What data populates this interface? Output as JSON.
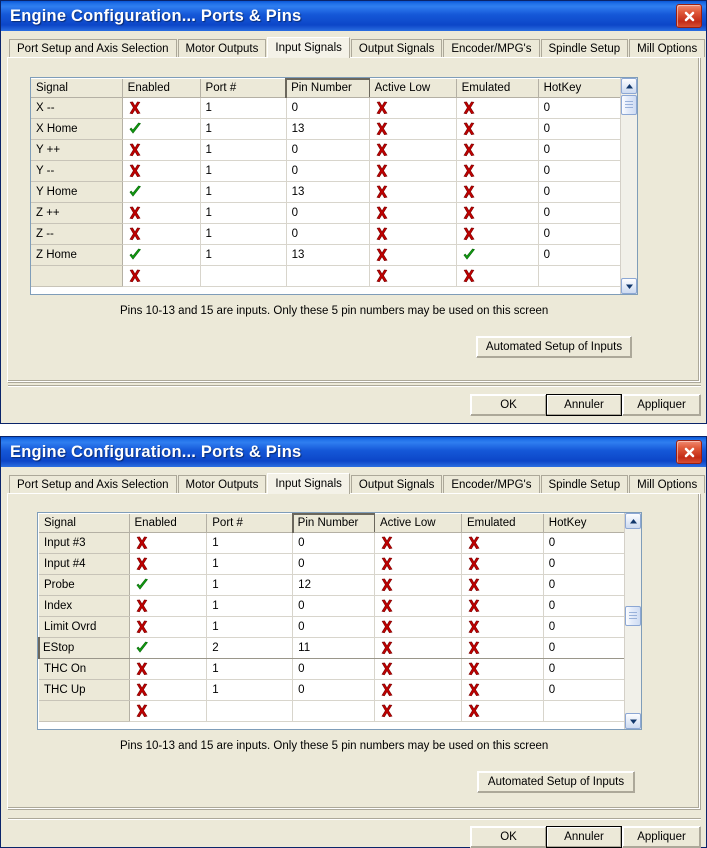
{
  "meta": {
    "accent_title_blue": "#1558d8",
    "dialog_face": "#ece9d8",
    "grid_border": "#7f9db9",
    "check_green": "#19a019",
    "cross_red": "#c00000"
  },
  "icons": {
    "close": "close-icon",
    "check": "green-check-icon",
    "cross": "red-cross-icon",
    "scroll_up": "chevron-up-icon",
    "scroll_down": "chevron-down-icon"
  },
  "dialogs": [
    {
      "title": "Engine Configuration... Ports & Pins",
      "close_label": "✕",
      "tabs": [
        {
          "label": "Port Setup and Axis Selection",
          "active": false
        },
        {
          "label": "Motor Outputs",
          "active": false
        },
        {
          "label": "Input Signals",
          "active": true
        },
        {
          "label": "Output Signals",
          "active": false
        },
        {
          "label": "Encoder/MPG's",
          "active": false
        },
        {
          "label": "Spindle Setup",
          "active": false
        },
        {
          "label": "Mill Options",
          "active": false
        }
      ],
      "grid": {
        "columns": [
          "Signal",
          "Enabled",
          "Port #",
          "Pin Number",
          "Active Low",
          "Emulated",
          "HotKey"
        ],
        "selected_column": "Pin Number",
        "selected_row": null,
        "rows": [
          {
            "signal": "X --",
            "enabled": "cross",
            "port": "1",
            "pin": "0",
            "active_low": "cross",
            "emulated": "cross",
            "hotkey": "0"
          },
          {
            "signal": "X Home",
            "enabled": "check",
            "port": "1",
            "pin": "13",
            "active_low": "cross",
            "emulated": "cross",
            "hotkey": "0"
          },
          {
            "signal": "Y ++",
            "enabled": "cross",
            "port": "1",
            "pin": "0",
            "active_low": "cross",
            "emulated": "cross",
            "hotkey": "0"
          },
          {
            "signal": "Y --",
            "enabled": "cross",
            "port": "1",
            "pin": "0",
            "active_low": "cross",
            "emulated": "cross",
            "hotkey": "0"
          },
          {
            "signal": "Y Home",
            "enabled": "check",
            "port": "1",
            "pin": "13",
            "active_low": "cross",
            "emulated": "cross",
            "hotkey": "0"
          },
          {
            "signal": "Z ++",
            "enabled": "cross",
            "port": "1",
            "pin": "0",
            "active_low": "cross",
            "emulated": "cross",
            "hotkey": "0"
          },
          {
            "signal": "Z --",
            "enabled": "cross",
            "port": "1",
            "pin": "0",
            "active_low": "cross",
            "emulated": "cross",
            "hotkey": "0"
          },
          {
            "signal": "Z Home",
            "enabled": "check",
            "port": "1",
            "pin": "13",
            "active_low": "cross",
            "emulated": "check",
            "hotkey": "0"
          }
        ],
        "scroll_position": "top"
      },
      "hint": "Pins 10-13 and 15 are inputs. Only these 5 pin numbers may be used on this screen",
      "auto_button": "Automated Setup of Inputs",
      "footer_buttons": [
        {
          "label": "OK",
          "default": false
        },
        {
          "label": "Annuler",
          "default": true
        },
        {
          "label": "Appliquer",
          "default": false
        }
      ]
    },
    {
      "title": "Engine Configuration... Ports & Pins",
      "close_label": "✕",
      "tabs": [
        {
          "label": "Port Setup and Axis Selection",
          "active": false
        },
        {
          "label": "Motor Outputs",
          "active": false
        },
        {
          "label": "Input Signals",
          "active": true
        },
        {
          "label": "Output Signals",
          "active": false
        },
        {
          "label": "Encoder/MPG's",
          "active": false
        },
        {
          "label": "Spindle Setup",
          "active": false
        },
        {
          "label": "Mill Options",
          "active": false
        }
      ],
      "grid": {
        "columns": [
          "Signal",
          "Enabled",
          "Port #",
          "Pin Number",
          "Active Low",
          "Emulated",
          "HotKey"
        ],
        "selected_column": "Pin Number",
        "selected_row": "EStop",
        "rows": [
          {
            "signal": "Input #3",
            "enabled": "cross",
            "port": "1",
            "pin": "0",
            "active_low": "cross",
            "emulated": "cross",
            "hotkey": "0"
          },
          {
            "signal": "Input #4",
            "enabled": "cross",
            "port": "1",
            "pin": "0",
            "active_low": "cross",
            "emulated": "cross",
            "hotkey": "0"
          },
          {
            "signal": "Probe",
            "enabled": "check",
            "port": "1",
            "pin": "12",
            "active_low": "cross",
            "emulated": "cross",
            "hotkey": "0"
          },
          {
            "signal": "Index",
            "enabled": "cross",
            "port": "1",
            "pin": "0",
            "active_low": "cross",
            "emulated": "cross",
            "hotkey": "0"
          },
          {
            "signal": "Limit Ovrd",
            "enabled": "cross",
            "port": "1",
            "pin": "0",
            "active_low": "cross",
            "emulated": "cross",
            "hotkey": "0"
          },
          {
            "signal": "EStop",
            "enabled": "check",
            "port": "2",
            "pin": "11",
            "active_low": "cross",
            "emulated": "cross",
            "hotkey": "0"
          },
          {
            "signal": "THC On",
            "enabled": "cross",
            "port": "1",
            "pin": "0",
            "active_low": "cross",
            "emulated": "cross",
            "hotkey": "0"
          },
          {
            "signal": "THC Up",
            "enabled": "cross",
            "port": "1",
            "pin": "0",
            "active_low": "cross",
            "emulated": "cross",
            "hotkey": "0"
          }
        ],
        "scroll_position": "middle"
      },
      "hint": "Pins 10-13 and 15 are inputs. Only these 5 pin numbers may be used on this screen",
      "auto_button": "Automated Setup of Inputs",
      "footer_buttons": [
        {
          "label": "OK",
          "default": false
        },
        {
          "label": "Annuler",
          "default": true
        },
        {
          "label": "Appliquer",
          "default": false
        }
      ]
    }
  ]
}
